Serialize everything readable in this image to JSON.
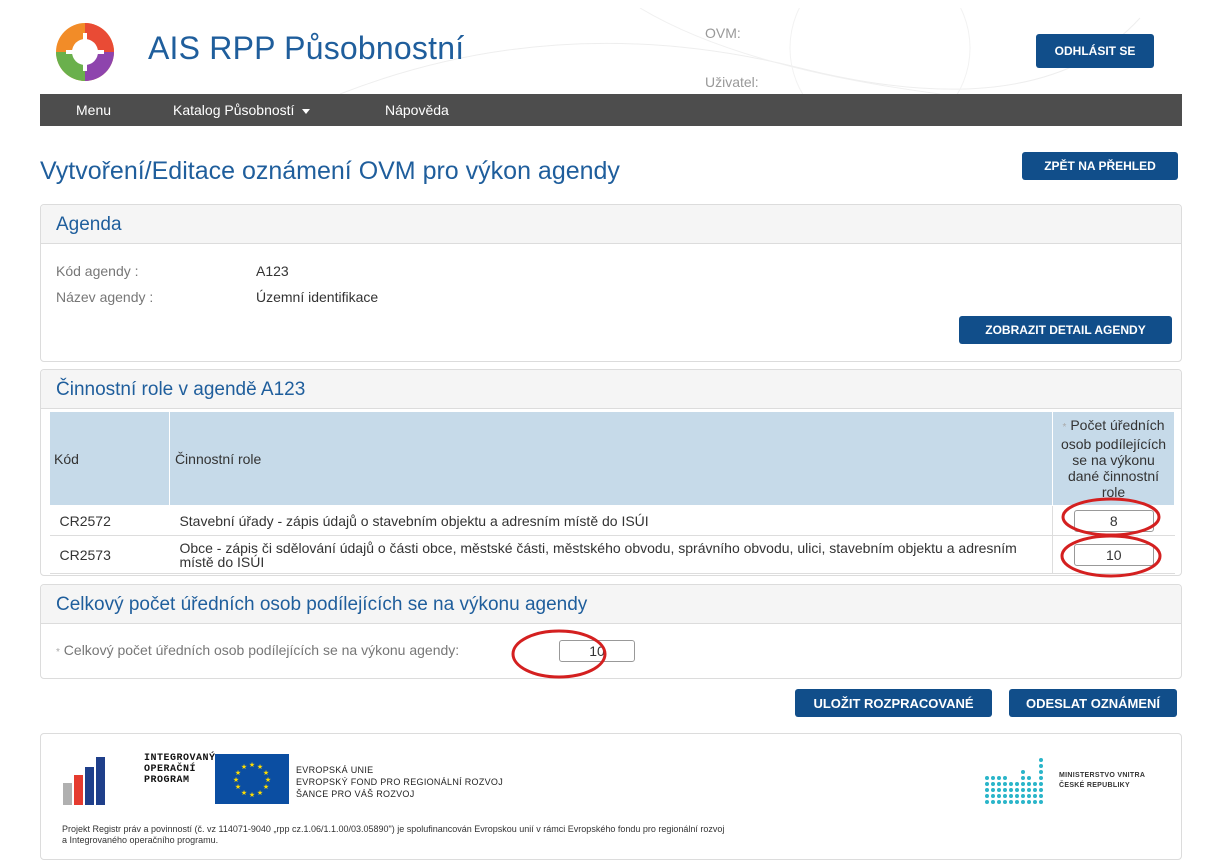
{
  "header": {
    "app_title": "AIS RPP Působnostní",
    "ovm_label": "OVM:",
    "user_label": "Uživatel:",
    "logout_label": "ODHLÁSIT SE"
  },
  "nav": {
    "items": [
      {
        "label": "Menu"
      },
      {
        "label": "Katalog Působností"
      },
      {
        "label": "Nápověda"
      }
    ]
  },
  "page": {
    "title": "Vytvoření/Editace oznámení OVM pro výkon agendy",
    "back_label": "ZPĚT NA PŘEHLED"
  },
  "agenda": {
    "heading": "Agenda",
    "code_label": "Kód agendy :",
    "code_value": "A123",
    "name_label": "Název agendy :",
    "name_value": "Územní identifikace",
    "detail_label": "ZOBRAZIT DETAIL AGENDY"
  },
  "roles": {
    "heading": "Činnostní role v agendě A123",
    "columns": {
      "code": "Kód",
      "role": "Činnostní role",
      "required_mark": "*",
      "count": "Počet úředních osob podílejících se na výkonu dané činnostní role"
    },
    "rows": [
      {
        "code": "CR2572",
        "role": "Stavební úřady - zápis údajů o stavebním objektu a adresním místě do ISÚI",
        "count": "8"
      },
      {
        "code": "CR2573",
        "role": "Obce - zápis či sdělování údajů o části obce, městské části, městského obvodu, správního obvodu, ulici, stavebním objektu a adresním místě do ISÚI",
        "count": "10"
      }
    ]
  },
  "total": {
    "heading": "Celkový počet úředních osob podílejících se na výkonu agendy",
    "required_mark": "*",
    "label": "Celkový počet úředních osob podílejících se na výkonu agendy:",
    "value": "10"
  },
  "actions": {
    "save_label": "ULOŽIT ROZPRACOVANÉ",
    "send_label": "ODESLAT OZNÁMENÍ"
  },
  "footer": {
    "iop_line1": "INTEGROVANÝ",
    "iop_line2": "OPERAČNÍ",
    "iop_line3": "PROGRAM",
    "eu_line1": "EVROPSKÁ UNIE",
    "eu_line2": "EVROPSKÝ FOND PRO REGIONÁLNÍ ROZVOJ",
    "eu_line3": "ŠANCE PRO VÁŠ ROZVOJ",
    "mv_line1": "MINISTERSTVO VNITRA",
    "mv_line2": "ČESKÉ REPUBLIKY",
    "note_line1": "Projekt Registr práv a povinností (č. vz 114071-9040 „rpp cz.1.06/1.1.00/03.05890\") je spolufinancován Evropskou unií v rámci Evropského fondu pro regionální rozvoj",
    "note_line2": "a Integrovaného operačního programu."
  },
  "colors": {
    "primary": "#114e8a",
    "title_blue": "#1f5e9c",
    "nav_bg": "#4d4d4d",
    "table_head": "#c6dae9",
    "highlight_circle": "#d42020"
  }
}
